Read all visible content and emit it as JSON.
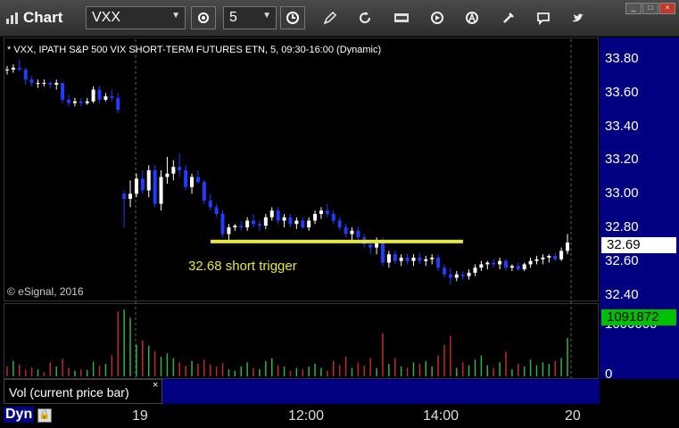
{
  "toolbar": {
    "app_title": "Chart",
    "symbol": "VXX",
    "interval": "5",
    "icons": [
      "gear-icon",
      "clock-icon",
      "pencil-icon",
      "refresh-icon",
      "get-icon",
      "play-icon",
      "a-icon",
      "tools-icon",
      "comment-icon",
      "twitter-icon"
    ]
  },
  "chart": {
    "title": "* VXX, IPATH S&P 500 VIX SHORT-TERM FUTURES ETN, 5, 09:30-16:00 (Dynamic)",
    "copyright": "© eSignal, 2016",
    "y_ticks": [
      "33.80",
      "33.60",
      "33.40",
      "33.20",
      "33.00",
      "32.80",
      "32.60",
      "32.40"
    ],
    "last_price": "32.69",
    "annotation": "32.68 short trigger",
    "colors": {
      "up": "#ffffff",
      "down": "#1f3cff",
      "trigger": "#e8e830",
      "axis_bg": "#000080",
      "vol_up": "#2db34a",
      "vol_down": "#c62828"
    }
  },
  "volume": {
    "label": "Vol (current price bar)",
    "close_symbol": "×",
    "y_ticks": [
      "1000000",
      "0"
    ],
    "last_value": "1091872"
  },
  "bottom": {
    "mode_label": "Dyn",
    "x_ticks": [
      "19",
      "12:00",
      "14:00",
      "20"
    ]
  },
  "chart_data": {
    "type": "candlestick",
    "y_range": [
      32.35,
      33.9
    ],
    "trigger_level": 32.68,
    "candles": [
      [
        33.72,
        33.74,
        33.69,
        33.72
      ],
      [
        33.72,
        33.75,
        33.7,
        33.73
      ],
      [
        33.73,
        33.78,
        33.71,
        33.72
      ],
      [
        33.72,
        33.73,
        33.63,
        33.66
      ],
      [
        33.66,
        33.68,
        33.62,
        33.64
      ],
      [
        33.64,
        33.66,
        33.61,
        33.64
      ],
      [
        33.64,
        33.66,
        33.62,
        33.64
      ],
      [
        33.64,
        33.65,
        33.61,
        33.63
      ],
      [
        33.63,
        33.66,
        33.6,
        33.64
      ],
      [
        33.64,
        33.64,
        33.52,
        33.54
      ],
      [
        33.54,
        33.57,
        33.5,
        33.52
      ],
      [
        33.52,
        33.55,
        33.5,
        33.53
      ],
      [
        33.53,
        33.55,
        33.5,
        33.52
      ],
      [
        33.52,
        33.55,
        33.51,
        33.53
      ],
      [
        33.53,
        33.62,
        33.52,
        33.6
      ],
      [
        33.6,
        33.62,
        33.52,
        33.54
      ],
      [
        33.54,
        33.58,
        33.53,
        33.56
      ],
      [
        33.56,
        33.6,
        33.53,
        33.55
      ],
      [
        33.55,
        33.58,
        33.46,
        33.48
      ],
      [
        32.98,
        33.0,
        32.78,
        32.95
      ],
      [
        32.95,
        33.06,
        32.9,
        32.98
      ],
      [
        32.98,
        33.1,
        32.96,
        33.07
      ],
      [
        33.07,
        33.12,
        32.98,
        33.0
      ],
      [
        33.0,
        33.15,
        32.96,
        33.12
      ],
      [
        33.12,
        33.15,
        32.9,
        32.92
      ],
      [
        32.92,
        33.12,
        32.88,
        33.08
      ],
      [
        33.08,
        33.2,
        33.04,
        33.1
      ],
      [
        33.1,
        33.18,
        33.06,
        33.14
      ],
      [
        33.14,
        33.22,
        33.08,
        33.12
      ],
      [
        33.12,
        33.15,
        33.0,
        33.02
      ],
      [
        33.02,
        33.1,
        32.98,
        33.08
      ],
      [
        33.08,
        33.12,
        33.04,
        33.05
      ],
      [
        33.05,
        33.06,
        32.92,
        32.94
      ],
      [
        32.94,
        32.98,
        32.88,
        32.9
      ],
      [
        32.9,
        32.92,
        32.84,
        32.86
      ],
      [
        32.86,
        32.88,
        32.72,
        32.74
      ],
      [
        32.74,
        32.8,
        32.7,
        32.78
      ],
      [
        32.78,
        32.8,
        32.76,
        32.79
      ],
      [
        32.79,
        32.82,
        32.76,
        32.78
      ],
      [
        32.78,
        32.84,
        32.76,
        32.82
      ],
      [
        32.82,
        32.86,
        32.78,
        32.8
      ],
      [
        32.8,
        32.82,
        32.76,
        32.79
      ],
      [
        32.79,
        32.86,
        32.77,
        32.84
      ],
      [
        32.84,
        32.9,
        32.82,
        32.88
      ],
      [
        32.88,
        32.9,
        32.8,
        32.82
      ],
      [
        32.82,
        32.86,
        32.78,
        32.84
      ],
      [
        32.84,
        32.86,
        32.78,
        32.8
      ],
      [
        32.8,
        32.84,
        32.77,
        32.82
      ],
      [
        32.82,
        32.84,
        32.77,
        32.78
      ],
      [
        32.78,
        32.84,
        32.76,
        32.82
      ],
      [
        32.82,
        32.88,
        32.8,
        32.86
      ],
      [
        32.86,
        32.9,
        32.83,
        32.88
      ],
      [
        32.88,
        32.92,
        32.84,
        32.86
      ],
      [
        32.86,
        32.88,
        32.8,
        32.82
      ],
      [
        32.82,
        32.84,
        32.76,
        32.78
      ],
      [
        32.78,
        32.8,
        32.72,
        32.74
      ],
      [
        32.74,
        32.78,
        32.7,
        32.76
      ],
      [
        32.76,
        32.78,
        32.7,
        32.72
      ],
      [
        32.72,
        32.74,
        32.66,
        32.68
      ],
      [
        32.68,
        32.7,
        32.62,
        32.66
      ],
      [
        32.66,
        32.72,
        32.62,
        32.7
      ],
      [
        32.7,
        32.72,
        32.55,
        32.57
      ],
      [
        32.57,
        32.64,
        32.54,
        32.62
      ],
      [
        32.62,
        32.64,
        32.56,
        32.58
      ],
      [
        32.58,
        32.62,
        32.55,
        32.6
      ],
      [
        32.6,
        32.62,
        32.56,
        32.58
      ],
      [
        32.58,
        32.62,
        32.55,
        32.6
      ],
      [
        32.6,
        32.63,
        32.56,
        32.58
      ],
      [
        32.58,
        32.61,
        32.55,
        32.59
      ],
      [
        32.59,
        32.62,
        32.56,
        32.6
      ],
      [
        32.6,
        32.62,
        32.52,
        32.54
      ],
      [
        32.54,
        32.56,
        32.48,
        32.5
      ],
      [
        32.5,
        32.54,
        32.44,
        32.48
      ],
      [
        32.48,
        32.52,
        32.46,
        32.5
      ],
      [
        32.5,
        32.52,
        32.47,
        32.49
      ],
      [
        32.49,
        32.53,
        32.47,
        32.51
      ],
      [
        32.51,
        32.56,
        32.49,
        32.54
      ],
      [
        32.54,
        32.58,
        32.52,
        32.56
      ],
      [
        32.56,
        32.58,
        32.53,
        32.57
      ],
      [
        32.57,
        32.59,
        32.54,
        32.56
      ],
      [
        32.56,
        32.6,
        32.53,
        32.58
      ],
      [
        32.58,
        32.59,
        32.52,
        32.54
      ],
      [
        32.54,
        32.56,
        32.52,
        32.55
      ],
      [
        32.55,
        32.57,
        32.52,
        32.53
      ],
      [
        32.53,
        32.57,
        32.52,
        32.56
      ],
      [
        32.56,
        32.6,
        32.54,
        32.58
      ],
      [
        32.58,
        32.61,
        32.56,
        32.59
      ],
      [
        32.59,
        32.62,
        32.56,
        32.6
      ],
      [
        32.6,
        32.62,
        32.57,
        32.61
      ],
      [
        32.61,
        32.63,
        32.58,
        32.59
      ],
      [
        32.59,
        32.66,
        32.58,
        32.64
      ],
      [
        32.64,
        32.74,
        32.62,
        32.69
      ]
    ],
    "volumes": [
      [
        0.14,
        0
      ],
      [
        0.22,
        1
      ],
      [
        0.17,
        0
      ],
      [
        0.09,
        0
      ],
      [
        0.13,
        0
      ],
      [
        0.1,
        1
      ],
      [
        0.06,
        0
      ],
      [
        0.2,
        0
      ],
      [
        0.14,
        1
      ],
      [
        0.25,
        0
      ],
      [
        0.12,
        0
      ],
      [
        0.08,
        1
      ],
      [
        0.1,
        0
      ],
      [
        0.09,
        1
      ],
      [
        0.21,
        1
      ],
      [
        0.15,
        0
      ],
      [
        0.18,
        1
      ],
      [
        0.3,
        0
      ],
      [
        0.93,
        0
      ],
      [
        0.96,
        1
      ],
      [
        0.84,
        1
      ],
      [
        0.45,
        1
      ],
      [
        0.52,
        0
      ],
      [
        0.44,
        1
      ],
      [
        0.36,
        0
      ],
      [
        0.28,
        1
      ],
      [
        0.33,
        1
      ],
      [
        0.26,
        1
      ],
      [
        0.2,
        0
      ],
      [
        0.15,
        0
      ],
      [
        0.22,
        1
      ],
      [
        0.18,
        0
      ],
      [
        0.24,
        0
      ],
      [
        0.17,
        0
      ],
      [
        0.14,
        0
      ],
      [
        0.19,
        0
      ],
      [
        0.1,
        1
      ],
      [
        0.08,
        1
      ],
      [
        0.14,
        1
      ],
      [
        0.2,
        1
      ],
      [
        0.12,
        0
      ],
      [
        0.1,
        1
      ],
      [
        0.22,
        1
      ],
      [
        0.26,
        1
      ],
      [
        0.16,
        0
      ],
      [
        0.14,
        1
      ],
      [
        0.08,
        0
      ],
      [
        0.12,
        1
      ],
      [
        0.1,
        0
      ],
      [
        0.14,
        1
      ],
      [
        0.18,
        1
      ],
      [
        0.12,
        1
      ],
      [
        0.08,
        0
      ],
      [
        0.22,
        0
      ],
      [
        0.16,
        0
      ],
      [
        0.28,
        0
      ],
      [
        0.12,
        1
      ],
      [
        0.2,
        0
      ],
      [
        0.15,
        0
      ],
      [
        0.26,
        0
      ],
      [
        0.12,
        1
      ],
      [
        0.62,
        0
      ],
      [
        0.18,
        1
      ],
      [
        0.26,
        0
      ],
      [
        0.14,
        1
      ],
      [
        0.12,
        0
      ],
      [
        0.2,
        1
      ],
      [
        0.18,
        0
      ],
      [
        0.22,
        1
      ],
      [
        0.14,
        1
      ],
      [
        0.3,
        0
      ],
      [
        0.45,
        0
      ],
      [
        0.58,
        0
      ],
      [
        0.12,
        1
      ],
      [
        0.2,
        0
      ],
      [
        0.16,
        1
      ],
      [
        0.24,
        1
      ],
      [
        0.3,
        1
      ],
      [
        0.16,
        1
      ],
      [
        0.12,
        0
      ],
      [
        0.2,
        1
      ],
      [
        0.35,
        0
      ],
      [
        0.1,
        1
      ],
      [
        0.18,
        0
      ],
      [
        0.14,
        1
      ],
      [
        0.24,
        1
      ],
      [
        0.16,
        1
      ],
      [
        0.2,
        1
      ],
      [
        0.18,
        1
      ],
      [
        0.22,
        0
      ],
      [
        0.26,
        1
      ],
      [
        0.55,
        1
      ]
    ]
  }
}
